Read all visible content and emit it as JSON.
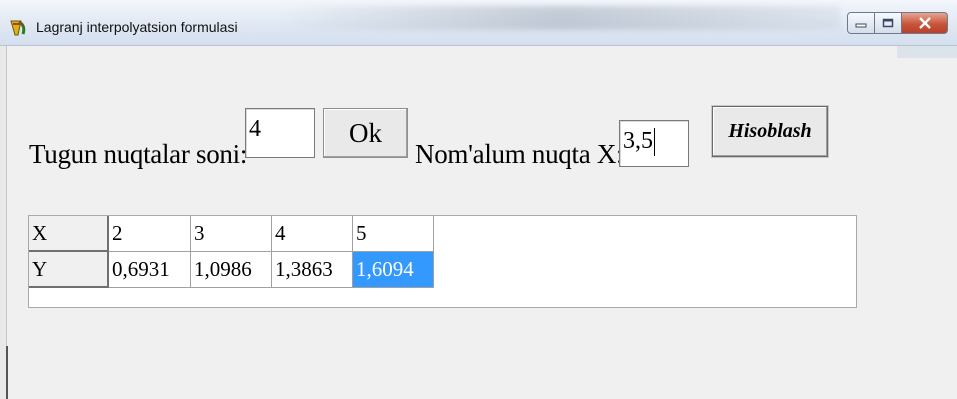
{
  "window": {
    "title": "Lagranj interpolyatsion formulasi",
    "icon": "app-icon"
  },
  "form": {
    "nodes_label": "Tugun nuqtalar soni:",
    "nodes_value": "4",
    "ok_label": "Ok",
    "point_label": "Nom'alum nuqta X:",
    "point_value": "3,5",
    "calc_label": "Hisoblash"
  },
  "grid": {
    "row_headers": [
      "X",
      "Y"
    ],
    "x_values": [
      "2",
      "3",
      "4",
      "5"
    ],
    "y_values": [
      "0,6931",
      "1,0986",
      "1,3863",
      "1,6094"
    ],
    "selected_color": "#3399ff"
  }
}
